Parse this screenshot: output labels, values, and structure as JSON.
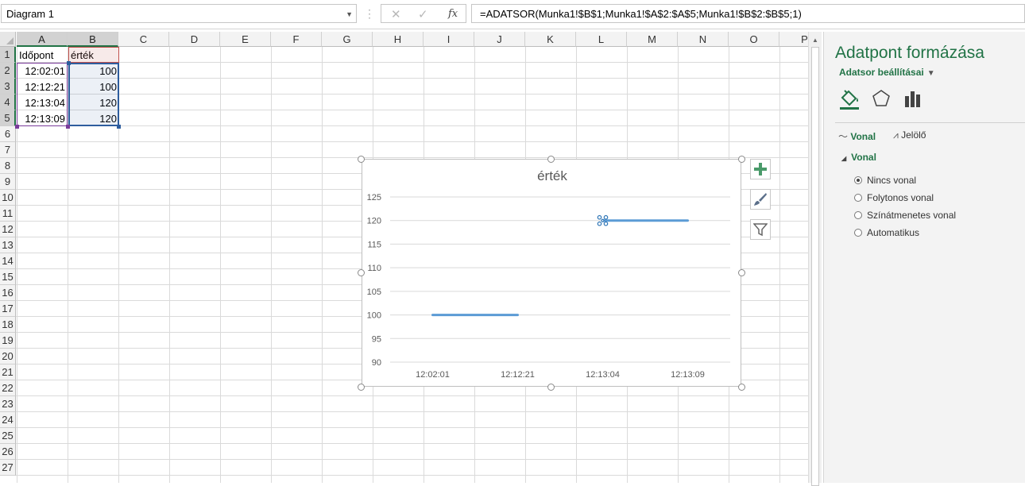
{
  "namebox": {
    "value": "Diagram 1"
  },
  "formula": {
    "text": "=ADATSOR(Munka1!$B$1;Munka1!$A$2:$A$5;Munka1!$B$2:$B$5;1)",
    "fx_label": "fx"
  },
  "grid": {
    "columns": [
      "A",
      "B",
      "C",
      "D",
      "E",
      "F",
      "G",
      "H",
      "I",
      "J",
      "K",
      "L",
      "M",
      "N",
      "O",
      "P"
    ],
    "rows": [
      "1",
      "2",
      "3",
      "4",
      "5",
      "6",
      "7",
      "8",
      "9",
      "10",
      "11",
      "12",
      "13",
      "14",
      "15",
      "16",
      "17",
      "18",
      "19",
      "20",
      "21",
      "22",
      "23",
      "24",
      "25",
      "26",
      "27"
    ],
    "cells": {
      "A1": "Időpont",
      "B1": "érték",
      "A2": "12:02:01",
      "B2": "100",
      "A3": "12:12:21",
      "B3": "100",
      "A4": "12:13:04",
      "B4": "120",
      "A5": "12:13:09",
      "B5": "120"
    }
  },
  "chart_data": {
    "type": "line",
    "title": "érték",
    "categories": [
      "12:02:01",
      "12:12:21",
      "12:13:04",
      "12:13:09"
    ],
    "series": [
      {
        "values": [
          100,
          100,
          120,
          120
        ]
      }
    ],
    "segments_visible": [
      [
        0,
        1
      ],
      [
        2,
        3
      ]
    ],
    "selected_point": 2,
    "y_ticks": [
      "125",
      "120",
      "115",
      "110",
      "105",
      "100",
      "95",
      "90"
    ],
    "ylim": [
      90,
      125
    ],
    "grid": true,
    "color": "#5b9bd5"
  },
  "pane": {
    "title": "Adatpont formázása",
    "subtitle": "Adatsor beállításai",
    "tabs": [
      "Vonal",
      "Jelölő"
    ],
    "section": "Vonal",
    "options": [
      "Nincs vonal",
      "Folytonos vonal",
      "Színátmenetes vonal",
      "Automatikus"
    ],
    "selected_option": 0,
    "accent_color": "#217346"
  }
}
